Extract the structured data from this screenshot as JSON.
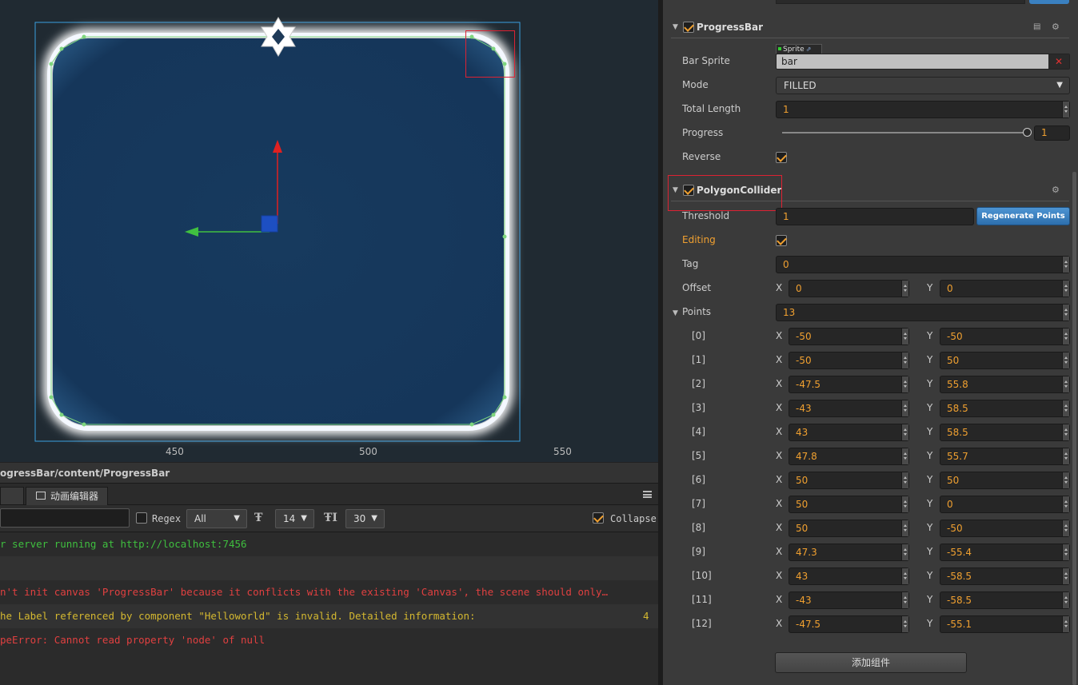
{
  "scene": {
    "ruler_labels": [
      "450",
      "500",
      "550"
    ]
  },
  "path_bar": "ogressBar/content/ProgressBar",
  "tabs": {
    "animation_editor": "动画编辑器"
  },
  "console_toolbar": {
    "regex_label": "Regex",
    "filter_value": "All",
    "font_size": "14",
    "line_height": "30",
    "collapse_label": "Collapse"
  },
  "console": {
    "lines": [
      {
        "text": "r server running at http://localhost:7456",
        "color": "#3fbf3f",
        "count": ""
      },
      {
        "text": "",
        "color": "#ccc",
        "count": ""
      },
      {
        "text": "n't init canvas 'ProgressBar' because it conflicts with the existing 'Canvas', the scene should only…",
        "color": "#e04040",
        "count": ""
      },
      {
        "text": "he Label referenced by component \"Helloworld\" is invalid. Detailed information:",
        "color": "#d4b830",
        "count": "4"
      },
      {
        "text": "peError: Cannot read property 'node' of null",
        "color": "#e04040",
        "count": ""
      }
    ]
  },
  "inspector": {
    "progressbar": {
      "title": "ProgressBar",
      "bar_sprite_label": "Bar Sprite",
      "sprite_tag": "Sprite",
      "bar_sprite_value": "bar",
      "mode_label": "Mode",
      "mode_value": "FILLED",
      "total_length_label": "Total Length",
      "total_length_value": "1",
      "progress_label": "Progress",
      "progress_value": "1",
      "progress_fraction": 1,
      "reverse_label": "Reverse"
    },
    "polygon": {
      "title": "PolygonCollider",
      "threshold_label": "Threshold",
      "threshold_value": "1",
      "regenerate_label": "Regenerate Points",
      "editing_label": "Editing",
      "tag_label": "Tag",
      "tag_value": "0",
      "offset_label": "Offset",
      "offset_x": "0",
      "offset_y": "0",
      "points_label": "Points",
      "points_count": "13",
      "points": [
        {
          "i": "[0]",
          "x": "-50",
          "y": "-50"
        },
        {
          "i": "[1]",
          "x": "-50",
          "y": "50"
        },
        {
          "i": "[2]",
          "x": "-47.5",
          "y": "55.8"
        },
        {
          "i": "[3]",
          "x": "-43",
          "y": "58.5"
        },
        {
          "i": "[4]",
          "x": "43",
          "y": "58.5"
        },
        {
          "i": "[5]",
          "x": "47.8",
          "y": "55.7"
        },
        {
          "i": "[6]",
          "x": "50",
          "y": "50"
        },
        {
          "i": "[7]",
          "x": "50",
          "y": "0"
        },
        {
          "i": "[8]",
          "x": "50",
          "y": "-50"
        },
        {
          "i": "[9]",
          "x": "47.3",
          "y": "-55.4"
        },
        {
          "i": "[10]",
          "x": "43",
          "y": "-58.5"
        },
        {
          "i": "[11]",
          "x": "-43",
          "y": "-58.5"
        },
        {
          "i": "[12]",
          "x": "-47.5",
          "y": "-55.1"
        }
      ]
    },
    "add_component": "添加组件"
  },
  "colors": {
    "accent_orange": "#f0a030",
    "highlight_red": "#d22",
    "button_blue": "#3a80c0"
  }
}
